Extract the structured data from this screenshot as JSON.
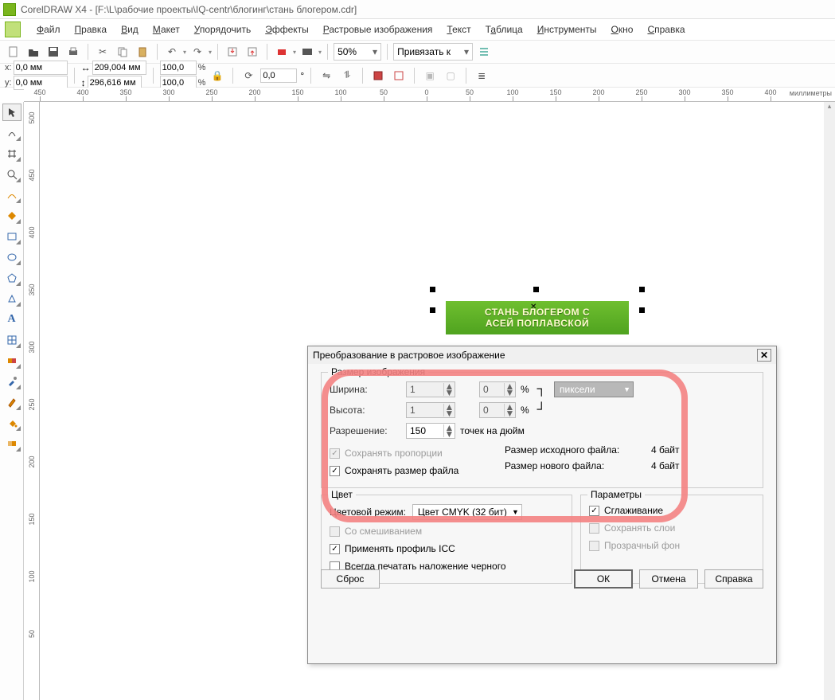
{
  "title": "CorelDRAW X4 - [F:\\L\\рабочие проекты\\IQ-centr\\блогинг\\стань блогером.cdr]",
  "menu": [
    "Файл",
    "Правка",
    "Вид",
    "Макет",
    "Упорядочить",
    "Эффекты",
    "Растровые изображения",
    "Текст",
    "Таблица",
    "Инструменты",
    "Окно",
    "Справка"
  ],
  "toolbar": {
    "zoom": "50%",
    "snap_label": "Привязать к"
  },
  "propbar": {
    "x_lbl": "x:",
    "x_val": "0,0 мм",
    "y_lbl": "y:",
    "y_val": "0,0 мм",
    "w_val": "209,004 мм",
    "h_val": "296,616 мм",
    "sx": "100,0",
    "sy": "100,0",
    "rot": "0,0"
  },
  "ruler_unit": "миллиметры",
  "ruler_h": [
    "450",
    "400",
    "350",
    "300",
    "250",
    "200",
    "150",
    "100",
    "50",
    "0",
    "50",
    "100",
    "150",
    "200",
    "250",
    "300",
    "350",
    "400"
  ],
  "ruler_v": [
    "500",
    "450",
    "400",
    "350",
    "300",
    "250",
    "200",
    "150",
    "100",
    "50"
  ],
  "object": {
    "line1": "СТАНЬ БЛОГЕРОМ С",
    "line2": "АСЕЙ ПОПЛАВСКОЙ"
  },
  "dialog": {
    "title": "Преобразование в растровое изображение",
    "size_legend": "Размер изображения",
    "width_lbl": "Ширина:",
    "width_val": "1",
    "width_pct_val": "0",
    "height_lbl": "Высота:",
    "height_val": "1",
    "height_pct_val": "0",
    "pct": "%",
    "units_selected": "пиксели",
    "res_lbl": "Разрешение:",
    "res_val": "150",
    "res_unit": "точек на дюйм",
    "keep_ratio": "Сохранять пропорции",
    "keep_size": "Сохранять размер файла",
    "src_size_lbl": "Размер исходного файла:",
    "src_size_val": "4 байт",
    "new_size_lbl": "Размер нового файла:",
    "new_size_val": "4 байт",
    "color_legend": "Цвет",
    "color_mode_lbl": "Цветовой режим:",
    "color_mode_val": "Цвет CMYK (32 бит)",
    "dither": "Со смешиванием",
    "icc": "Применять профиль ICC",
    "overprint": "Всегда печатать наложение черного",
    "params_legend": "Параметры",
    "antialias": "Сглаживание",
    "layers": "Сохранять слои",
    "transparent": "Прозрачный фон",
    "reset": "Сброс",
    "ok": "ОК",
    "cancel": "Отмена",
    "help": "Справка"
  }
}
